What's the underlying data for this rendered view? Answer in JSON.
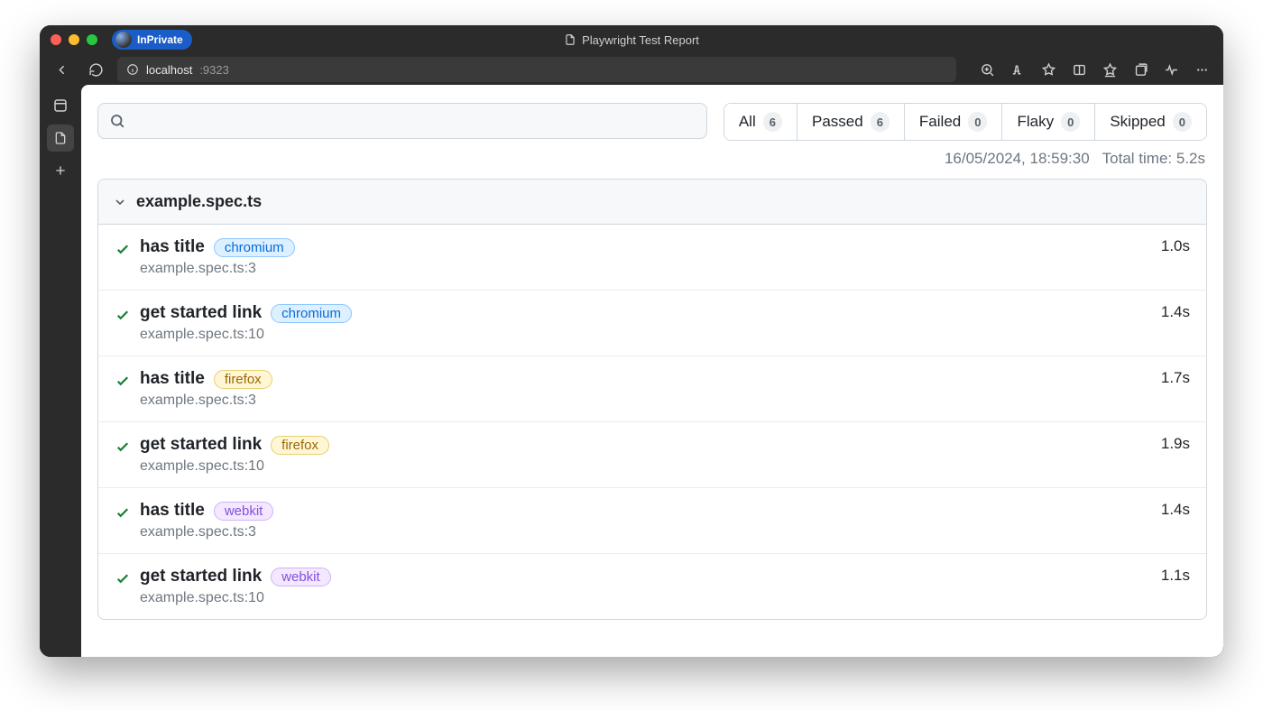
{
  "browser": {
    "inprivate_label": "InPrivate",
    "tab_title": "Playwright Test Report",
    "url_host": "localhost",
    "url_port": ":9323"
  },
  "filters": {
    "all": {
      "label": "All",
      "count": "6"
    },
    "passed": {
      "label": "Passed",
      "count": "6"
    },
    "failed": {
      "label": "Failed",
      "count": "0"
    },
    "flaky": {
      "label": "Flaky",
      "count": "0"
    },
    "skipped": {
      "label": "Skipped",
      "count": "0"
    }
  },
  "search": {
    "placeholder": ""
  },
  "meta": {
    "timestamp": "16/05/2024, 18:59:30",
    "total_time": "Total time: 5.2s"
  },
  "file": {
    "name": "example.spec.ts"
  },
  "tests": [
    {
      "name": "has title",
      "browser": "chromium",
      "location": "example.spec.ts:3",
      "duration": "1.0s"
    },
    {
      "name": "get started link",
      "browser": "chromium",
      "location": "example.spec.ts:10",
      "duration": "1.4s"
    },
    {
      "name": "has title",
      "browser": "firefox",
      "location": "example.spec.ts:3",
      "duration": "1.7s"
    },
    {
      "name": "get started link",
      "browser": "firefox",
      "location": "example.spec.ts:10",
      "duration": "1.9s"
    },
    {
      "name": "has title",
      "browser": "webkit",
      "location": "example.spec.ts:3",
      "duration": "1.4s"
    },
    {
      "name": "get started link",
      "browser": "webkit",
      "location": "example.spec.ts:10",
      "duration": "1.1s"
    }
  ]
}
